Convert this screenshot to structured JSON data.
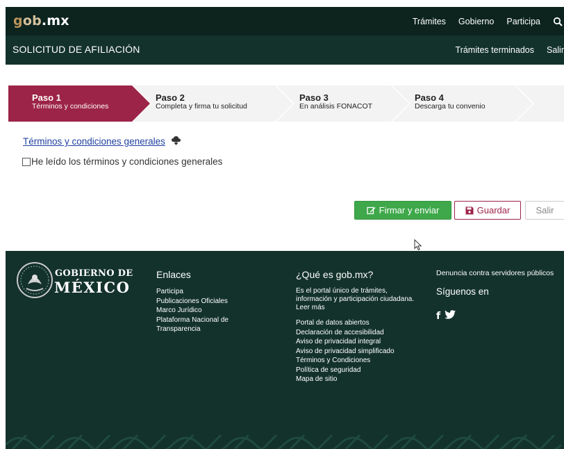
{
  "header": {
    "brand": {
      "g": "g",
      "ob": "ob",
      "dot": ".",
      "mx": "mx"
    },
    "nav": [
      "Trámites",
      "Gobierno",
      "Participa"
    ],
    "search_icon": "search-icon"
  },
  "subheader": {
    "title": "SOLICITUD DE AFILIACIÓN",
    "links": [
      "Trámites terminados",
      "Salir"
    ]
  },
  "steps": [
    {
      "title": "Paso 1",
      "subtitle": "Términos y condiciones",
      "active": true
    },
    {
      "title": "Paso 2",
      "subtitle": "Completa y firma tu solicitud",
      "active": false
    },
    {
      "title": "Paso 3",
      "subtitle": "En análisis FONACOT",
      "active": false
    },
    {
      "title": "Paso 4",
      "subtitle": "Descarga tu convenio",
      "active": false
    }
  ],
  "content": {
    "terms_link": "Términos y condiciones generales",
    "checkbox_label": "He leído los términos y condiciones generales",
    "checkbox_checked": false
  },
  "actions": {
    "sign_label": "Firmar y enviar",
    "save_label": "Guardar",
    "exit_label": "Salir"
  },
  "footer": {
    "gobierno": "GOBIERNO DE",
    "mexico": "MÉXICO",
    "links_title": "Enlaces",
    "links": [
      "Participa",
      "Publicaciones Oficiales",
      "Marco Jurídico",
      "Plataforma Nacional de",
      "Transparencia"
    ],
    "about_title": "¿Qué es gob.mx?",
    "about_desc": "Es el portal único de trámites, información y participación ciudadana. Leer más",
    "about_links": [
      "Portal de datos abiertos",
      "Declaración de accesibilidad",
      "Aviso de privacidad integral",
      "Aviso de privacidad simplificado",
      "Términos y Condiciones",
      "Política de seguridad",
      "Mapa de sitio"
    ],
    "denuncia": "Denuncia contra servidores públicos",
    "follow_title": "Síguenos en",
    "facebook": "f"
  },
  "colors": {
    "topbar": "#0c231e",
    "subbar": "#13322b",
    "accent": "#9d2449",
    "success": "#3ea84a",
    "brand_gold": "#bc955c"
  }
}
